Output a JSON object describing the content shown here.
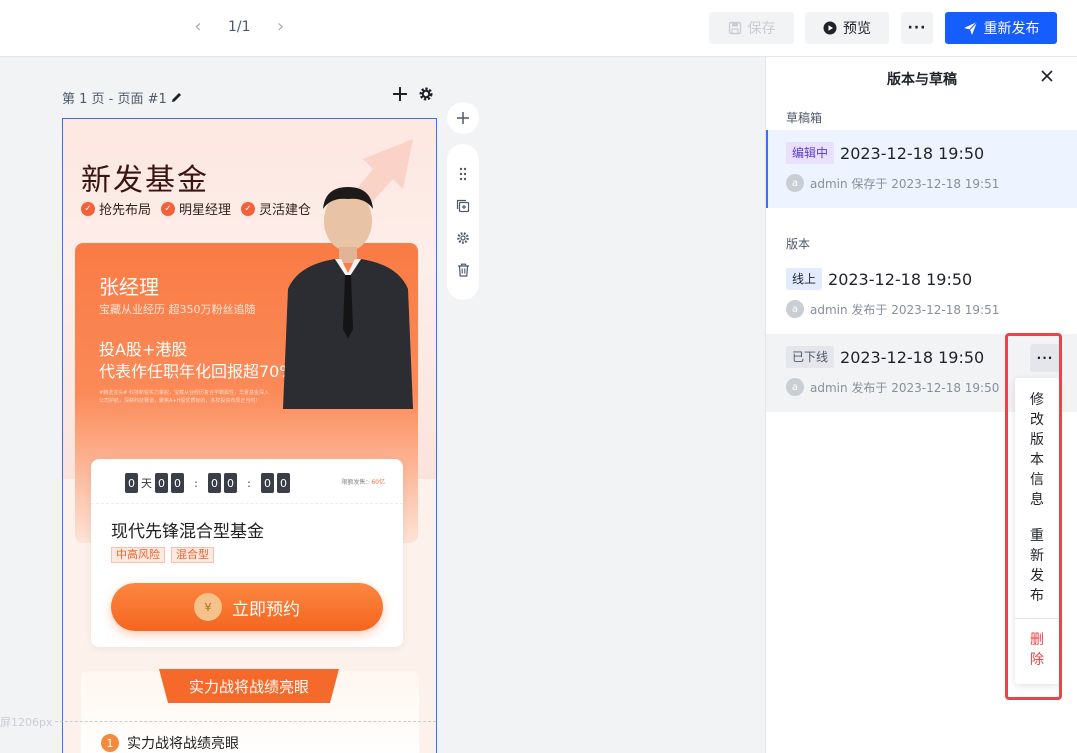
{
  "topbar": {
    "page_indicator": "1/1",
    "prev_icon": "chevron-left-icon",
    "next_icon": "chevron-right-icon",
    "save_label": "保存",
    "preview_label": "预览",
    "more_label": "···",
    "publish_label": "重新发布"
  },
  "canvas": {
    "page_label": "第 1 页 - 页面 #1",
    "fold_label": "屏1206px"
  },
  "poster": {
    "title": "新发基金",
    "tags": [
      "抢先布局",
      "明星经理",
      "灵活建仓"
    ],
    "manager_name": "张经理",
    "manager_sub": "宝藏从业经历 超350万粉丝追随",
    "slogan_line1": "投A股+港股",
    "slogan_line2": "代表作任职年化回报超70%",
    "fine_print": "#精选龙头# 科技新锐实力掌舵，宝藏从业经历复合学霸属性，华夏基金深入公司护航，深耕科技赛道，聚焦A+H股优质标的，多样投资布局正当时！",
    "countdown": {
      "days": "0",
      "day_unit": "天",
      "h1": "0",
      "h2": "0",
      "m1": "0",
      "m2": "0",
      "s1": "0",
      "s2": "0",
      "sep": ":"
    },
    "open_time_label": "限额发售：",
    "open_time_value": "60亿",
    "fund_name": "现代先锋混合型基金",
    "fund_tags": [
      "中高风险",
      "混合型"
    ],
    "cta_label": "立即预约",
    "cta_icon_text": "¥",
    "section_ribbon": "实力战将战绩亮眼",
    "section_item_num": "1",
    "section_item_text": "实力战将战绩亮眼"
  },
  "panel": {
    "title": "版本与草稿",
    "drafts_heading": "草稿箱",
    "versions_heading": "版本",
    "draft": {
      "badge": "编辑中",
      "time": "2023-12-18 19:50",
      "avatar": "a",
      "meta": "admin 保存于 2023-12-18 19:51"
    },
    "versions": [
      {
        "badge": "线上",
        "time": "2023-12-18 19:50",
        "avatar": "a",
        "meta": "admin 发布于 2023-12-18 19:51"
      },
      {
        "badge": "已下线",
        "time": "2023-12-18 19:50",
        "avatar": "a",
        "meta": "admin 发布于 2023-12-18 19:50"
      }
    ],
    "row_more": "···"
  },
  "dropdown": {
    "items": [
      {
        "label": "修改版本信息",
        "danger": false
      },
      {
        "label": "重新发布",
        "danger": false
      },
      {
        "label": "删除",
        "danger": true
      }
    ]
  },
  "colors": {
    "primary": "#165dff",
    "danger": "#f53f3f",
    "poster_orange": "#f5651f",
    "highlight": "#e8454a"
  }
}
